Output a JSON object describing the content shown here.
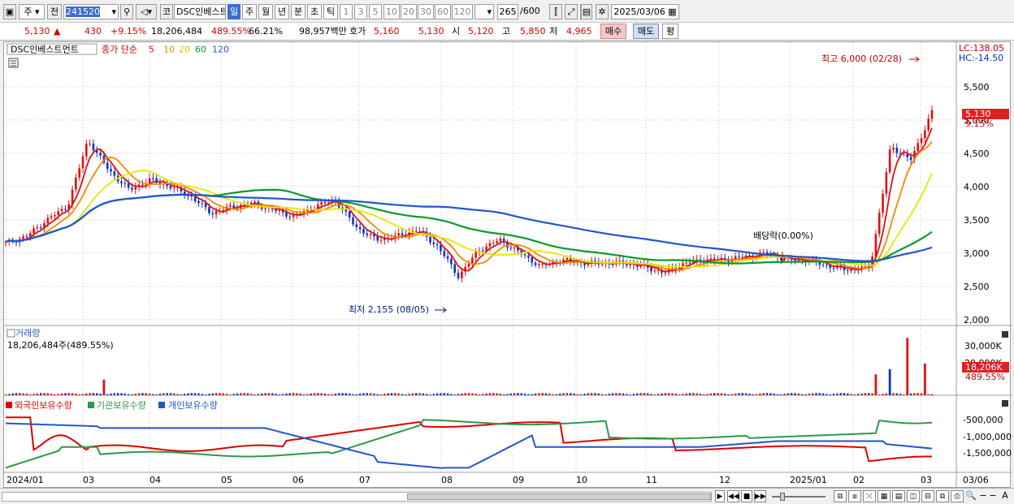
{
  "toolbar": {
    "market_select": "주",
    "prev_label": "전",
    "code": "241520",
    "type_label": "코",
    "name": "DSC인베스트",
    "periods": [
      "일",
      "주",
      "월",
      "년",
      "분",
      "초",
      "틱"
    ],
    "active_period": "일",
    "intervals": [
      "1",
      "3",
      "5",
      "10",
      "20",
      "30",
      "60",
      "120"
    ],
    "count": "265",
    "count_total": "/600",
    "date": "2025/03/06"
  },
  "quote": {
    "price": "5,130",
    "arrow": "▲",
    "change": "430",
    "change_pct": "+9.15%",
    "volume": "18,206,484",
    "vol_ratio": "489.55%",
    "turnover": "66.21%",
    "amount": "98,957백만",
    "hoga_label": "호가",
    "hoga1": "5,160",
    "hoga2": "5,130",
    "open_label": "시",
    "open": "5,120",
    "high_label": "고",
    "high": "5,850",
    "low_label": "저",
    "low": "4,965",
    "buy_button": "매수",
    "sell_button": "매도",
    "eval_button": "평"
  },
  "chart_data": [
    {
      "type": "line",
      "name": "price",
      "legend": {
        "name": "DSC인베스트먼트",
        "type": "종가 단순",
        "ma_periods": [
          "5",
          "10",
          "20",
          "60",
          "120"
        ],
        "ma_colors": [
          "#e01010",
          "#f08a00",
          "#e6e600",
          "#0a9a2a",
          "#2255cc"
        ]
      },
      "lc": "LC:138.05",
      "hc": "HC:-14.50",
      "current_price_label": "5,130",
      "current_pct_label": "9.15%",
      "yticks": [
        2000,
        2500,
        3000,
        3500,
        4000,
        4500,
        5000,
        5500
      ],
      "ytick_labels": [
        "2,000",
        "2,500",
        "3,000",
        "3,500",
        "4,000",
        "4,500",
        "5,000",
        "5,500"
      ],
      "ylim": [
        1950,
        5900
      ],
      "annotations": [
        {
          "text": "최고 6,000 (02/28)",
          "color": "#c00000"
        },
        {
          "text": "최저 2,155 (08/05)",
          "color": "#002080"
        },
        {
          "text": "배당락(0.00%)",
          "color": "#000000"
        }
      ],
      "x_months": [
        "2024/01",
        "03",
        "04",
        "05",
        "06",
        "07",
        "08",
        "09",
        "10",
        "11",
        "12",
        "2025/01",
        "02",
        "03",
        "03/06"
      ],
      "close_series": [
        3150,
        3250,
        3500,
        3700,
        4700,
        4250,
        3950,
        4100,
        4000,
        3850,
        3600,
        3700,
        3750,
        3650,
        3550,
        3700,
        3800,
        3400,
        3200,
        3250,
        3350,
        3100,
        2650,
        3050,
        3200,
        3000,
        2800,
        2900,
        2850,
        2850,
        2850,
        2800,
        2700,
        2850,
        2900,
        2900,
        2950,
        3000,
        2900,
        2900,
        2800,
        2750,
        2800,
        4600,
        4400,
        5130
      ]
    },
    {
      "type": "bar",
      "name": "volume",
      "title": "거래량",
      "summary": "18,206,484주(489.55%)",
      "current_label": "18,206K",
      "current_pct": "489.55%",
      "yticks": [
        "30,000K",
        "20,000K"
      ],
      "spikes": [
        {
          "label": "03",
          "value": 9000
        },
        {
          "label": "02",
          "value": 12000
        },
        {
          "label": "02",
          "value": 15000
        },
        {
          "label": "03",
          "value": 33000
        },
        {
          "label": "03",
          "value": 18206
        }
      ]
    },
    {
      "type": "line",
      "name": "holders",
      "series": [
        {
          "name": "외국인보유수량",
          "color": "#e00000"
        },
        {
          "name": "기관보유수량",
          "color": "#2a9a4a"
        },
        {
          "name": "개인보유수량",
          "color": "#2255cc"
        }
      ],
      "ytick_labels": [
        "-500,000",
        "-1,000,000",
        "-1,500,000"
      ]
    }
  ]
}
